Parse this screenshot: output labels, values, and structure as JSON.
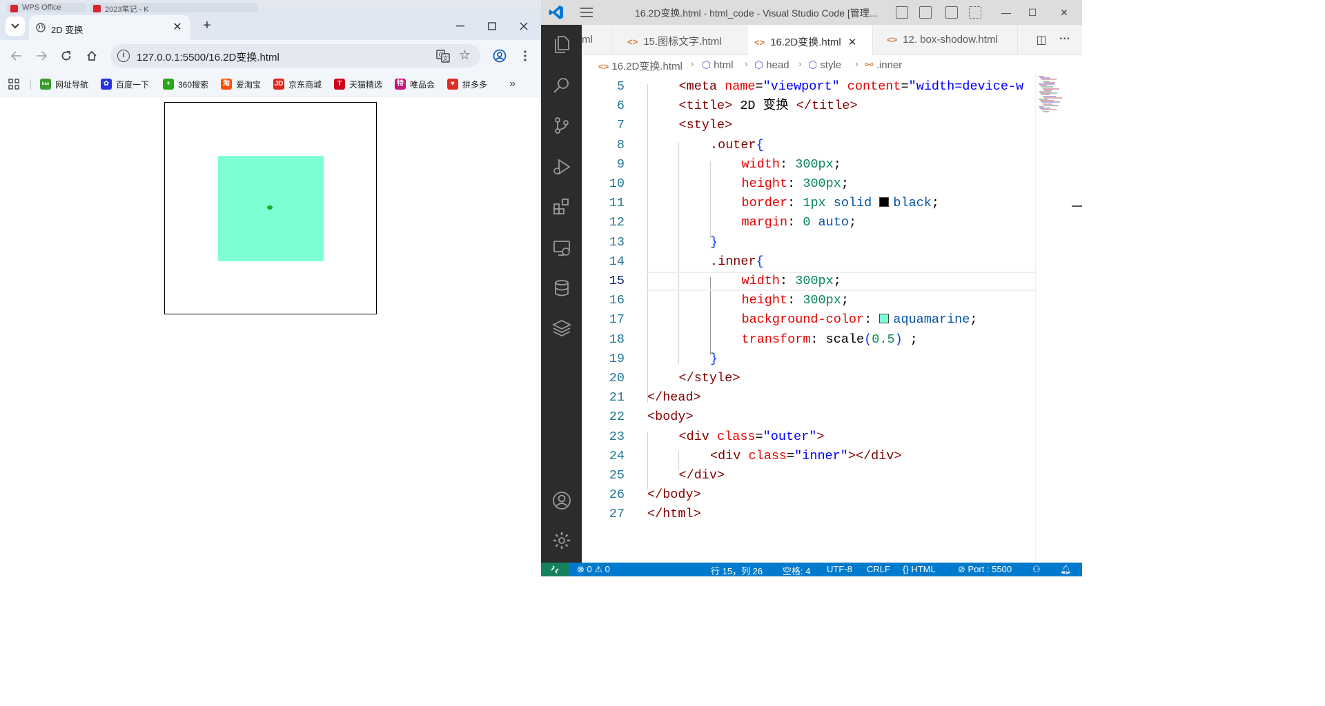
{
  "browser": {
    "background_tabs": [
      "WPS Office",
      "2023笔记 - K"
    ],
    "active_tab": {
      "title": "2D 变换"
    },
    "omnibox": {
      "url": "127.0.0.1:5500/16.2D变换.html"
    },
    "bookmarks": [
      {
        "label": "网址导航",
        "icon": "hao-icon",
        "color": "#3a9b2c",
        "glyph": "hao"
      },
      {
        "label": "百度一下",
        "icon": "baidu-paw-icon",
        "color": "#2932e1",
        "glyph": "✿"
      },
      {
        "label": "360搜索",
        "icon": "360-icon",
        "color": "#2aa515",
        "glyph": "+"
      },
      {
        "label": "爱淘宝",
        "icon": "taobao-icon",
        "color": "#ff5000",
        "glyph": "淘"
      },
      {
        "label": "京东商城",
        "icon": "jd-icon",
        "color": "#e1251b",
        "glyph": "JD"
      },
      {
        "label": "天猫精选",
        "icon": "tmall-icon",
        "color": "#d0021b",
        "glyph": "T"
      },
      {
        "label": "唯品会",
        "icon": "vip-icon",
        "color": "#c8157e",
        "glyph": "特"
      },
      {
        "label": "拼多多",
        "icon": "pinduoduo-icon",
        "color": "#e02e24",
        "glyph": "♥"
      }
    ],
    "page_colors": {
      "inner_box": "#7fffd4",
      "outer_border": "#000000"
    }
  },
  "vscode": {
    "title": "16.2D变换.html - html_code - Visual Studio Code [管理...",
    "tabs": [
      {
        "label": "ml",
        "active": false
      },
      {
        "label": "15.图标文字.html",
        "active": false
      },
      {
        "label": "16.2D变换.html",
        "active": true
      },
      {
        "label": "12. box-shodow.html",
        "active": false
      }
    ],
    "breadcrumb": [
      "16.2D变换.html",
      "html",
      "head",
      "style",
      ".inner"
    ],
    "current_line": 15,
    "lines": [
      {
        "n": 5,
        "indent": 1,
        "parts": [
          [
            "tag",
            "<meta "
          ],
          [
            "attr",
            "name"
          ],
          [
            "txt",
            "="
          ],
          [
            "str",
            "\"viewport\""
          ],
          [
            "txt",
            " "
          ],
          [
            "attr",
            "content"
          ],
          [
            "txt",
            "="
          ],
          [
            "str",
            "\"width=device-w"
          ]
        ]
      },
      {
        "n": 6,
        "indent": 1,
        "parts": [
          [
            "tag",
            "<title>"
          ],
          [
            "txt",
            " 2D 变换 "
          ],
          [
            "tag",
            "</title>"
          ]
        ]
      },
      {
        "n": 7,
        "indent": 1,
        "parts": [
          [
            "tag",
            "<style>"
          ]
        ]
      },
      {
        "n": 8,
        "indent": 2,
        "parts": [
          [
            "sel",
            ".outer"
          ],
          [
            "br",
            "{"
          ]
        ]
      },
      {
        "n": 9,
        "indent": 3,
        "parts": [
          [
            "prop",
            "width"
          ],
          [
            "txt",
            ": "
          ],
          [
            "num",
            "300px"
          ],
          [
            "txt",
            ";"
          ]
        ]
      },
      {
        "n": 10,
        "indent": 3,
        "parts": [
          [
            "prop",
            "height"
          ],
          [
            "txt",
            ": "
          ],
          [
            "num",
            "300px"
          ],
          [
            "txt",
            ";"
          ]
        ]
      },
      {
        "n": 11,
        "indent": 3,
        "parts": [
          [
            "prop",
            "border"
          ],
          [
            "txt",
            ": "
          ],
          [
            "num",
            "1px"
          ],
          [
            "txt",
            " "
          ],
          [
            "kw",
            "solid"
          ],
          [
            "txt",
            " "
          ],
          [
            "swatch",
            "#000000"
          ],
          [
            "kw",
            "black"
          ],
          [
            "txt",
            ";"
          ]
        ]
      },
      {
        "n": 12,
        "indent": 3,
        "parts": [
          [
            "prop",
            "margin"
          ],
          [
            "txt",
            ": "
          ],
          [
            "num",
            "0"
          ],
          [
            "txt",
            " "
          ],
          [
            "kw",
            "auto"
          ],
          [
            "txt",
            ";"
          ]
        ]
      },
      {
        "n": 13,
        "indent": 2,
        "parts": [
          [
            "br",
            "}"
          ]
        ]
      },
      {
        "n": 14,
        "indent": 2,
        "parts": [
          [
            "sel",
            ".inner"
          ],
          [
            "br",
            "{"
          ]
        ]
      },
      {
        "n": 15,
        "indent": 3,
        "parts": [
          [
            "prop",
            "width"
          ],
          [
            "txt",
            ": "
          ],
          [
            "num",
            "300px"
          ],
          [
            "txt",
            ";"
          ]
        ]
      },
      {
        "n": 16,
        "indent": 3,
        "parts": [
          [
            "prop",
            "height"
          ],
          [
            "txt",
            ": "
          ],
          [
            "num",
            "300px"
          ],
          [
            "txt",
            ";"
          ]
        ]
      },
      {
        "n": 17,
        "indent": 3,
        "parts": [
          [
            "prop",
            "background-color"
          ],
          [
            "txt",
            ": "
          ],
          [
            "swatch",
            "#7fffd4"
          ],
          [
            "kw",
            "aquamarine"
          ],
          [
            "txt",
            ";"
          ]
        ]
      },
      {
        "n": 18,
        "indent": 3,
        "parts": [
          [
            "prop",
            "transform"
          ],
          [
            "txt",
            ": "
          ],
          [
            "txt",
            "scale"
          ],
          [
            "br",
            "("
          ],
          [
            "num",
            "0.5"
          ],
          [
            "br",
            ")"
          ],
          [
            "txt",
            " ;"
          ]
        ]
      },
      {
        "n": 19,
        "indent": 2,
        "parts": [
          [
            "br",
            "}"
          ]
        ]
      },
      {
        "n": 20,
        "indent": 1,
        "parts": [
          [
            "tag",
            "</style>"
          ]
        ]
      },
      {
        "n": 21,
        "indent": 0,
        "parts": [
          [
            "tag",
            "</head>"
          ]
        ]
      },
      {
        "n": 22,
        "indent": 0,
        "parts": [
          [
            "tag",
            "<body>"
          ]
        ]
      },
      {
        "n": 23,
        "indent": 1,
        "parts": [
          [
            "tag",
            "<div "
          ],
          [
            "attr",
            "class"
          ],
          [
            "txt",
            "="
          ],
          [
            "str",
            "\"outer\""
          ],
          [
            "tag",
            ">"
          ]
        ]
      },
      {
        "n": 24,
        "indent": 2,
        "parts": [
          [
            "tag",
            "<div "
          ],
          [
            "attr",
            "class"
          ],
          [
            "txt",
            "="
          ],
          [
            "str",
            "\"inner\""
          ],
          [
            "tag",
            "></div>"
          ]
        ]
      },
      {
        "n": 25,
        "indent": 1,
        "parts": [
          [
            "tag",
            "</div>"
          ]
        ]
      },
      {
        "n": 26,
        "indent": 0,
        "parts": [
          [
            "tag",
            "</body>"
          ]
        ]
      },
      {
        "n": 27,
        "indent": 0,
        "parts": [
          [
            "tag",
            "</html>"
          ]
        ]
      }
    ],
    "status": {
      "problems": "0",
      "warnings": "0",
      "position": "行 15，列 26",
      "spaces": "空格: 4",
      "encoding": "UTF-8",
      "eol": "CRLF",
      "language": "HTML",
      "port": "Port : 5500"
    }
  }
}
